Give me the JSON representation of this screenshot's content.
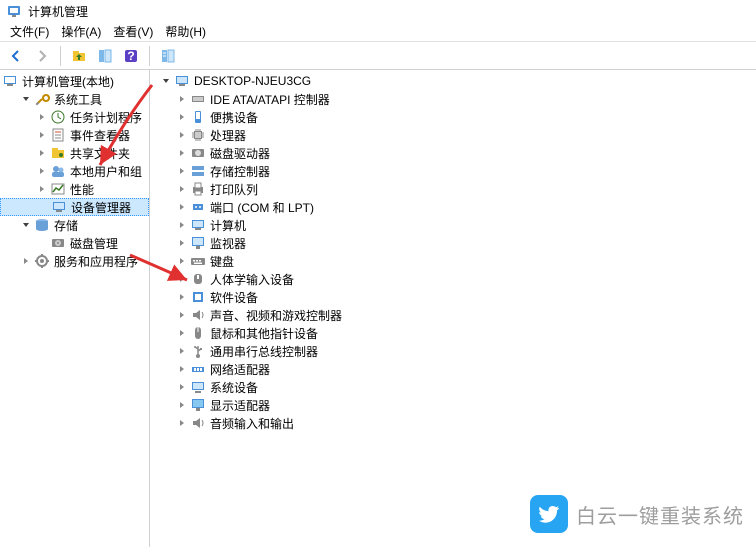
{
  "window": {
    "title": "计算机管理"
  },
  "menu": {
    "file": "文件(F)",
    "action": "操作(A)",
    "view": "查看(V)",
    "help": "帮助(H)"
  },
  "sidebar": {
    "root": "计算机管理(本地)",
    "groups": [
      {
        "label": "系统工具",
        "expanded": true,
        "icon": "tools",
        "items": [
          {
            "label": "任务计划程序",
            "icon": "clock",
            "expandable": true
          },
          {
            "label": "事件查看器",
            "icon": "event",
            "expandable": true
          },
          {
            "label": "共享文件夹",
            "icon": "share",
            "expandable": true
          },
          {
            "label": "本地用户和组",
            "icon": "users",
            "expandable": true
          },
          {
            "label": "性能",
            "icon": "perf",
            "expandable": true
          },
          {
            "label": "设备管理器",
            "icon": "device",
            "expandable": false,
            "selected": true
          }
        ]
      },
      {
        "label": "存储",
        "expanded": true,
        "icon": "storage",
        "items": [
          {
            "label": "磁盘管理",
            "icon": "disk",
            "expandable": false
          }
        ]
      },
      {
        "label": "服务和应用程序",
        "expanded": false,
        "icon": "services",
        "items": []
      }
    ]
  },
  "devices": {
    "root": "DESKTOP-NJEU3CG",
    "categories": [
      {
        "label": "IDE ATA/ATAPI 控制器",
        "icon": "ide"
      },
      {
        "label": "便携设备",
        "icon": "portable"
      },
      {
        "label": "处理器",
        "icon": "cpu"
      },
      {
        "label": "磁盘驱动器",
        "icon": "diskdrive"
      },
      {
        "label": "存储控制器",
        "icon": "storage-ctrl"
      },
      {
        "label": "打印队列",
        "icon": "printer"
      },
      {
        "label": "端口 (COM 和 LPT)",
        "icon": "port"
      },
      {
        "label": "计算机",
        "icon": "computer"
      },
      {
        "label": "监视器",
        "icon": "monitor"
      },
      {
        "label": "键盘",
        "icon": "keyboard"
      },
      {
        "label": "人体学输入设备",
        "icon": "hid"
      },
      {
        "label": "软件设备",
        "icon": "software"
      },
      {
        "label": "声音、视频和游戏控制器",
        "icon": "sound"
      },
      {
        "label": "鼠标和其他指针设备",
        "icon": "mouse"
      },
      {
        "label": "通用串行总线控制器",
        "icon": "usb"
      },
      {
        "label": "网络适配器",
        "icon": "network"
      },
      {
        "label": "系统设备",
        "icon": "system"
      },
      {
        "label": "显示适配器",
        "icon": "display"
      },
      {
        "label": "音频输入和输出",
        "icon": "audio"
      }
    ]
  },
  "watermark": {
    "text": "白云一键重装系统"
  }
}
